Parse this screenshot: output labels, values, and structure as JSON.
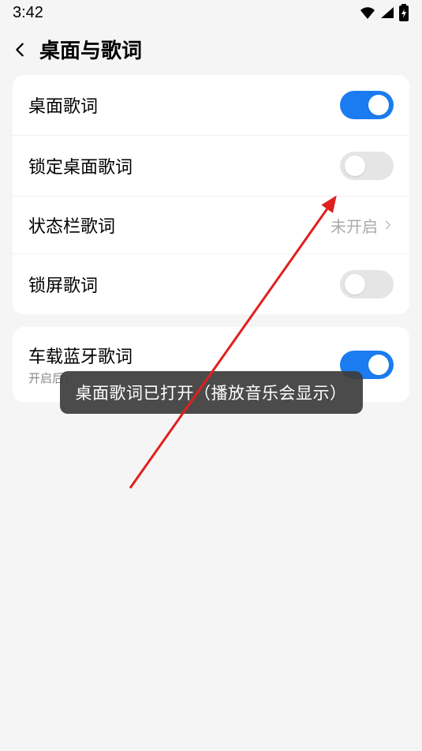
{
  "statusBar": {
    "time": "3:42"
  },
  "header": {
    "title": "桌面与歌词"
  },
  "group1": {
    "row0": {
      "label": "桌面歌词",
      "toggle": "on"
    },
    "row1": {
      "label": "锁定桌面歌词",
      "toggle": "off"
    },
    "row2": {
      "label": "状态栏歌词",
      "value": "未开启"
    },
    "row3": {
      "label": "锁屏歌词",
      "toggle": "off"
    }
  },
  "group2": {
    "row0": {
      "label": "车载蓝牙歌词",
      "sub": "开启后，",
      "toggle": "on"
    }
  },
  "toast": {
    "text": "桌面歌词已打开（播放音乐会显示）"
  }
}
